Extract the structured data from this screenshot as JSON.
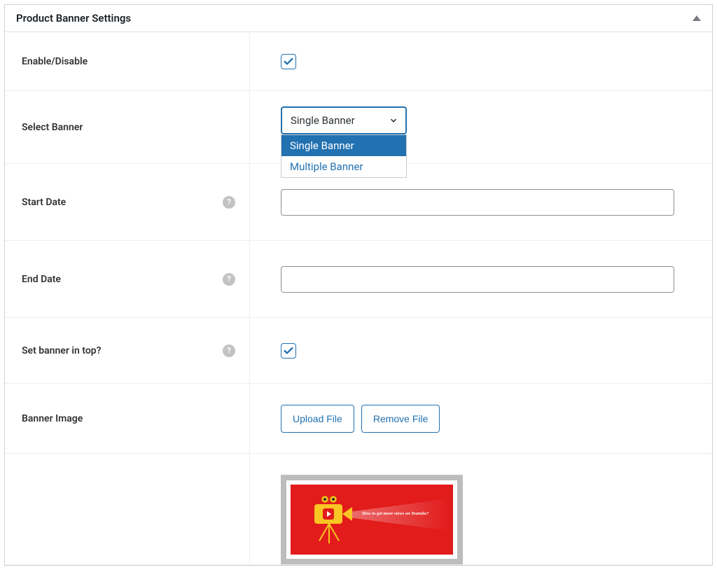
{
  "panel": {
    "title": "Product Banner Settings"
  },
  "fields": {
    "enable": {
      "label": "Enable/Disable",
      "checked": true
    },
    "selectBanner": {
      "label": "Select Banner",
      "selected": "Single Banner",
      "options": [
        "Single Banner",
        "Multiple Banner"
      ]
    },
    "startDate": {
      "label": "Start Date",
      "value": ""
    },
    "endDate": {
      "label": "End Date",
      "value": ""
    },
    "bannerTop": {
      "label": "Set banner in top?",
      "checked": true
    },
    "bannerImage": {
      "label": "Banner Image",
      "uploadLabel": "Upload File",
      "removeLabel": "Remove File"
    }
  },
  "preview": {
    "text": "How to get more views on Youtube?"
  }
}
